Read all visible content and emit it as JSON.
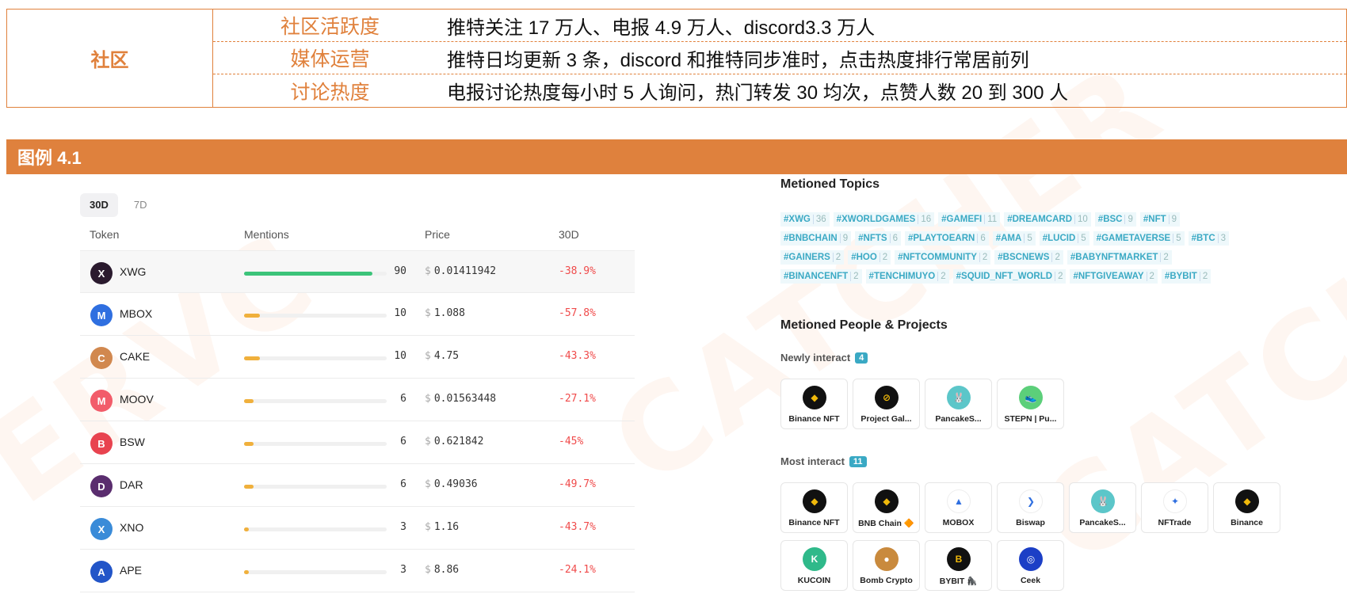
{
  "community_table": {
    "category": "社区",
    "rows": [
      {
        "label": "社区活跃度",
        "value": "推特关注 17 万人、电报 4.9 万人、discord3.3 万人"
      },
      {
        "label": "媒体运营",
        "value": "推特日均更新 3 条，discord 和推特同步准时，点击热度排行常居前列"
      },
      {
        "label": "讨论热度",
        "value": "电报讨论热度每小时 5 人询问，热门转发 30 均次，点赞人数 20 到 300 人"
      }
    ]
  },
  "figure": {
    "title": "图例 4.1"
  },
  "tokens_panel": {
    "tabs": [
      "30D",
      "7D"
    ],
    "headers": {
      "token": "Token",
      "mentions": "Mentions",
      "price": "Price",
      "change": "30D"
    },
    "currency": "$",
    "rows": [
      {
        "name": "XWG",
        "mentions": 90,
        "mentions_text": "90",
        "price": "0.01411942",
        "change": "-38.9%",
        "logo_color": "#2a1a2e",
        "bar_color": "#3cc47a",
        "icon": "xwg-icon"
      },
      {
        "name": "MBOX",
        "mentions": 10,
        "mentions_text": "10",
        "price": "1.088",
        "change": "-57.8%",
        "logo_color": "#2f6fe0",
        "bar_color": "#f0b03c",
        "icon": "mbox-icon"
      },
      {
        "name": "CAKE",
        "mentions": 10,
        "mentions_text": "10",
        "price": "4.75",
        "change": "-43.3%",
        "logo_color": "#d1884f",
        "bar_color": "#f0b03c",
        "icon": "cake-icon"
      },
      {
        "name": "MOOV",
        "mentions": 6,
        "mentions_text": "6",
        "price": "0.01563448",
        "change": "-27.1%",
        "logo_color": "#f25c6a",
        "bar_color": "#f0b03c",
        "icon": "moov-icon"
      },
      {
        "name": "BSW",
        "mentions": 6,
        "mentions_text": "6",
        "price": "0.621842",
        "change": "-45%",
        "logo_color": "#e8434f",
        "bar_color": "#f0b03c",
        "icon": "bsw-icon"
      },
      {
        "name": "DAR",
        "mentions": 6,
        "mentions_text": "6",
        "price": "0.49036",
        "change": "-49.7%",
        "logo_color": "#5a2d6e",
        "bar_color": "#f0b03c",
        "icon": "dar-icon"
      },
      {
        "name": "XNO",
        "mentions": 3,
        "mentions_text": "3",
        "price": "1.16",
        "change": "-43.7%",
        "logo_color": "#3a8bd8",
        "bar_color": "#f0b03c",
        "icon": "xno-icon"
      },
      {
        "name": "APE",
        "mentions": 3,
        "mentions_text": "3",
        "price": "8.86",
        "change": "-24.1%",
        "logo_color": "#2255c8",
        "bar_color": "#f0b03c",
        "icon": "ape-icon"
      }
    ]
  },
  "topics_panel": {
    "title": "Metioned Topics",
    "lines": [
      [
        {
          "tag": "#XWG",
          "count": "36"
        },
        {
          "tag": "#XWORLDGAMES",
          "count": "16"
        },
        {
          "tag": "#GAMEFI",
          "count": "11"
        },
        {
          "tag": "#DREAMCARD",
          "count": "10"
        },
        {
          "tag": "#BSC",
          "count": "9"
        },
        {
          "tag": "#NFT",
          "count": "9"
        }
      ],
      [
        {
          "tag": "#BNBCHAIN",
          "count": "9"
        },
        {
          "tag": "#NFTS",
          "count": "6"
        },
        {
          "tag": "#PLAYTOEARN",
          "count": "6"
        },
        {
          "tag": "#AMA",
          "count": "5"
        },
        {
          "tag": "#LUCID",
          "count": "5"
        },
        {
          "tag": "#GAMETAVERSE",
          "count": "5"
        },
        {
          "tag": "#BTC",
          "count": "3"
        }
      ],
      [
        {
          "tag": "#GAINERS",
          "count": "2"
        },
        {
          "tag": "#HOO",
          "count": "2"
        },
        {
          "tag": "#NFTCOMMUNITY",
          "count": "2"
        },
        {
          "tag": "#BSCNEWS",
          "count": "2"
        },
        {
          "tag": "#BABYNFTMARKET",
          "count": "2"
        }
      ],
      [
        {
          "tag": "#BINANCENFT",
          "count": "2"
        },
        {
          "tag": "#TENCHIMUYO",
          "count": "2"
        },
        {
          "tag": "#SQUID_NFT_WORLD",
          "count": "2"
        },
        {
          "tag": "#NFTGIVEAWAY",
          "count": "2"
        },
        {
          "tag": "#BYBIT",
          "count": "2"
        }
      ]
    ]
  },
  "people_panel": {
    "title": "Metioned People & Projects",
    "newly": {
      "label": "Newly interact",
      "count": "4",
      "items": [
        {
          "name": "Binance NFT",
          "color": "#111",
          "icon": "binance-nft-icon",
          "glyph": "◆"
        },
        {
          "name": "Project Gal...",
          "color": "#111",
          "icon": "project-galaxy-icon",
          "glyph": "⊘"
        },
        {
          "name": "PancakeS...",
          "color": "#5cc6c9",
          "icon": "pancakeswap-icon",
          "glyph": "🐰"
        },
        {
          "name": "STEPN | Pu...",
          "color": "#5ccf7a",
          "icon": "stepn-icon",
          "glyph": "👟"
        }
      ]
    },
    "most": {
      "label": "Most interact",
      "count": "11",
      "items": [
        {
          "name": "Binance NFT",
          "color": "#111",
          "icon": "binance-nft-icon",
          "glyph": "◆"
        },
        {
          "name": "BNB Chain 🔶",
          "color": "#111",
          "icon": "bnb-chain-icon",
          "glyph": "◆"
        },
        {
          "name": "MOBOX",
          "color": "#ffffff",
          "icon": "mobox-icon",
          "glyph": "▲"
        },
        {
          "name": "Biswap",
          "color": "#ffffff",
          "icon": "biswap-icon",
          "glyph": "❯"
        },
        {
          "name": "PancakeS...",
          "color": "#5cc6c9",
          "icon": "pancakeswap-icon",
          "glyph": "🐰"
        },
        {
          "name": "NFTrade",
          "color": "#ffffff",
          "icon": "nftrade-icon",
          "glyph": "✦"
        },
        {
          "name": "Binance",
          "color": "#111",
          "icon": "binance-icon",
          "glyph": "◆"
        },
        {
          "name": "KUCOIN",
          "color": "#2fb98a",
          "icon": "kucoin-icon",
          "glyph": "K"
        },
        {
          "name": "Bomb Crypto",
          "color": "#c98a3d",
          "icon": "bomb-crypto-icon",
          "glyph": "●"
        },
        {
          "name": "BYBIT 🦍",
          "color": "#111",
          "icon": "bybit-icon",
          "glyph": "B"
        },
        {
          "name": "Ceek",
          "color": "#1c3fc6",
          "icon": "ceek-icon",
          "glyph": "◎"
        }
      ]
    }
  }
}
